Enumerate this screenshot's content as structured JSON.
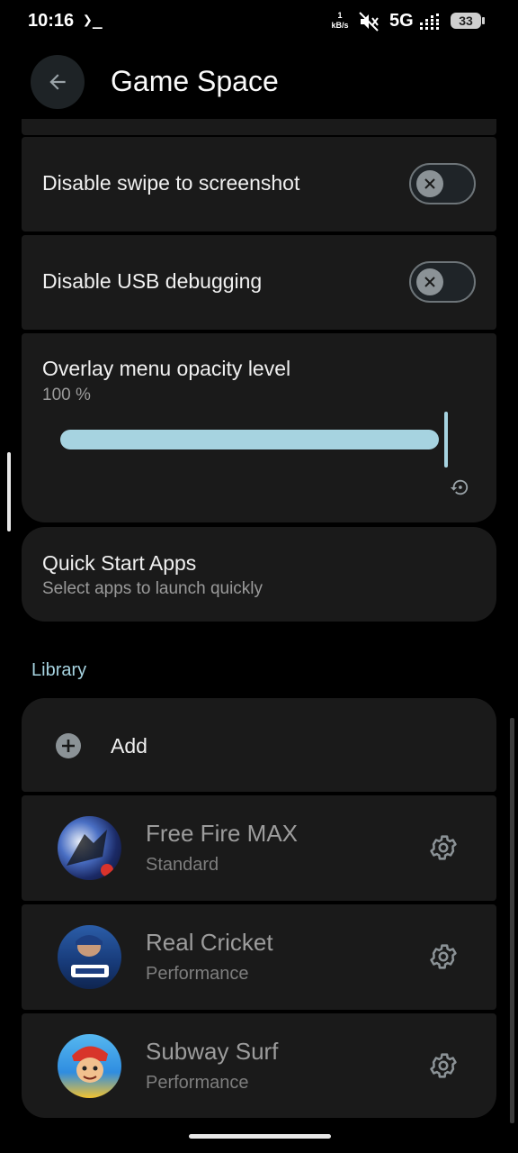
{
  "status_bar": {
    "time": "10:16",
    "terminal_glyph": "❯_",
    "net_rate_value": "1",
    "net_rate_unit": "kB/s",
    "network": "5G",
    "battery": "33"
  },
  "header": {
    "title": "Game Space",
    "back_icon": "arrow-back-icon"
  },
  "settings": {
    "swipe_screenshot": {
      "label": "Disable swipe to screenshot",
      "enabled": false
    },
    "usb_debugging": {
      "label": "Disable USB debugging",
      "enabled": false
    },
    "overlay_opacity": {
      "label": "Overlay menu opacity level",
      "value_text": "100 %",
      "value": 100
    },
    "quick_start": {
      "title": "Quick Start Apps",
      "subtitle": "Select apps to launch quickly"
    }
  },
  "library": {
    "section_label": "Library",
    "add_label": "Add",
    "apps": [
      {
        "name": "Free Fire MAX",
        "mode": "Standard"
      },
      {
        "name": "Real Cricket",
        "mode": "Performance"
      },
      {
        "name": "Subway Surf",
        "mode": "Performance"
      }
    ]
  },
  "colors": {
    "accent": "#a6d3e0",
    "card_bg": "#1a1a1a",
    "background": "#000000"
  }
}
